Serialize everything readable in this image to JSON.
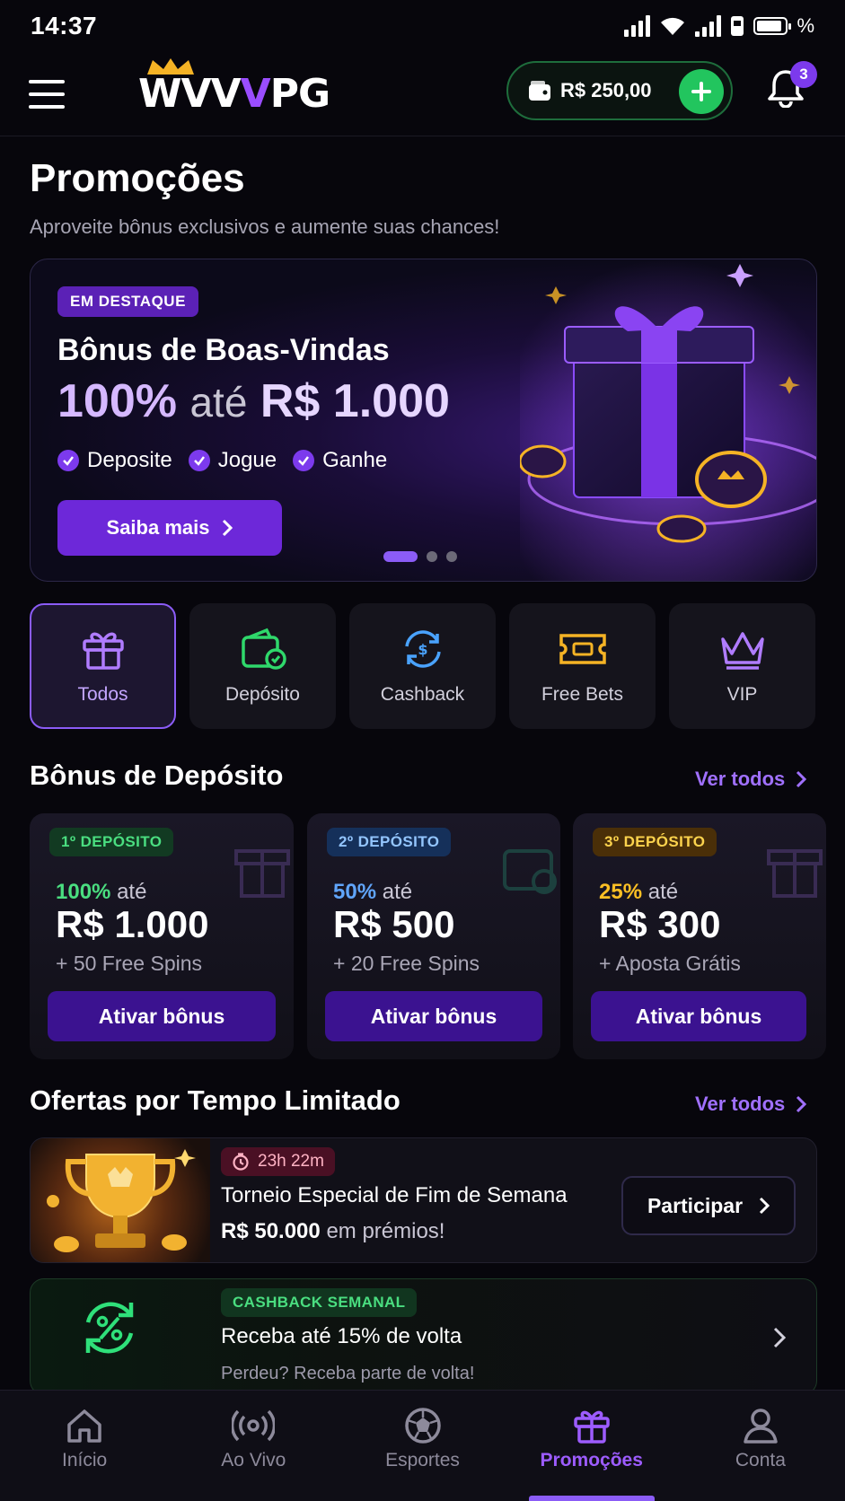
{
  "status_bar": {
    "time": "14:37",
    "battery_percent_symbol": "%"
  },
  "header": {
    "logo_white": "WVV",
    "logo_purple": "V",
    "logo_tail": "PG",
    "balance": "R$ 250,00",
    "notification_count": "3"
  },
  "page": {
    "title": "Promoções",
    "subtitle": "Aproveite bônus exclusivos e aumente suas chances!"
  },
  "hero": {
    "tag": "EM DESTAQUE",
    "title": "Bônus de Boas-Vindas",
    "percent": "100%",
    "until": "até",
    "amount": "R$ 1.000",
    "steps": [
      "Deposite",
      "Jogue",
      "Ganhe"
    ],
    "cta": "Saiba mais",
    "slides_total": 3,
    "slide_active": 1
  },
  "categories": [
    {
      "label": "Todos",
      "icon": "gift-icon",
      "active": true
    },
    {
      "label": "Depósito",
      "icon": "wallet-icon",
      "active": false
    },
    {
      "label": "Cashback",
      "icon": "cashback-icon",
      "active": false
    },
    {
      "label": "Free Bets",
      "icon": "ticket-icon",
      "active": false
    },
    {
      "label": "VIP",
      "icon": "crown-icon",
      "active": false
    }
  ],
  "deposit_section": {
    "title": "Bônus de Depósito",
    "see_all": "Ver todos",
    "cards": [
      {
        "tag": "1º DEPÓSITO",
        "percent": "100%",
        "until": "até",
        "amount": "R$ 1.000",
        "extra": "+ 50 Free Spins",
        "button": "Ativar bônus",
        "accent": "#4ade80"
      },
      {
        "tag": "2º DEPÓSITO",
        "percent": "50%",
        "until": "até",
        "amount": "R$ 500",
        "extra": "+ 20 Free Spins",
        "button": "Ativar bônus",
        "accent": "#60a5fa"
      },
      {
        "tag": "3º DEPÓSITO",
        "percent": "25%",
        "until": "até",
        "amount": "R$ 300",
        "extra": "+ Aposta Grátis",
        "button": "Ativar bônus",
        "accent": "#fbbf24"
      }
    ]
  },
  "limited_section": {
    "title": "Ofertas por Tempo Limitado",
    "see_all": "Ver todos",
    "tournament": {
      "timer": "23h 22m",
      "title": "Torneio Especial de Fim de Semana",
      "prize": "R$ 50.000",
      "prize_suffix": "em prémios!",
      "button": "Participar"
    },
    "cashback": {
      "tag": "CASHBACK SEMANAL",
      "title": "Receba até 15% de volta",
      "subtitle": "Perdeu? Receba parte de volta!"
    }
  },
  "bottom_nav": [
    {
      "label": "Início",
      "icon": "home-icon",
      "active": false
    },
    {
      "label": "Ao Vivo",
      "icon": "live-icon",
      "active": false
    },
    {
      "label": "Esportes",
      "icon": "soccer-ball-icon",
      "active": false
    },
    {
      "label": "Promoções",
      "icon": "gift-icon",
      "active": true
    },
    {
      "label": "Conta",
      "icon": "user-icon",
      "active": false
    }
  ],
  "colors": {
    "accent_purple": "#8b5cf6",
    "green": "#22c55e",
    "background": "#07060c"
  }
}
